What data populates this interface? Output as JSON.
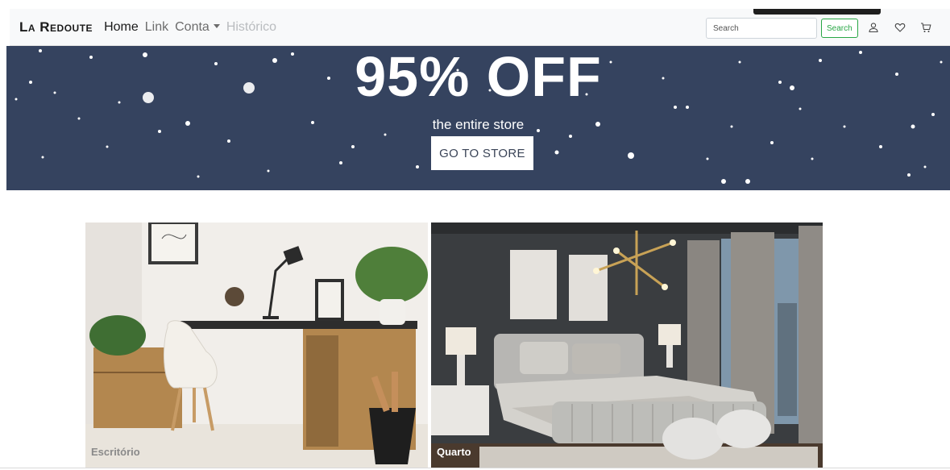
{
  "navbar": {
    "brand": "La Redoute",
    "links": [
      {
        "label": "Home",
        "state": "active"
      },
      {
        "label": "Link",
        "state": "normal"
      },
      {
        "label": "Conta",
        "state": "dropdown"
      },
      {
        "label": "Histórico",
        "state": "disabled"
      }
    ],
    "search": {
      "placeholder": "Search",
      "button_label": "Search"
    },
    "icons": [
      "user-icon",
      "heart-icon",
      "cart-icon"
    ]
  },
  "hero": {
    "title": "95% OFF",
    "subtitle": "the entire store",
    "button_label": "GO TO STORE",
    "background_color": "#35435f"
  },
  "categories": [
    {
      "label": "Escritório",
      "image": "office-desk-photo"
    },
    {
      "label": "Quarto",
      "image": "bedroom-photo"
    }
  ],
  "colors": {
    "accent_green": "#28a745",
    "hero_navy": "#35435f"
  }
}
